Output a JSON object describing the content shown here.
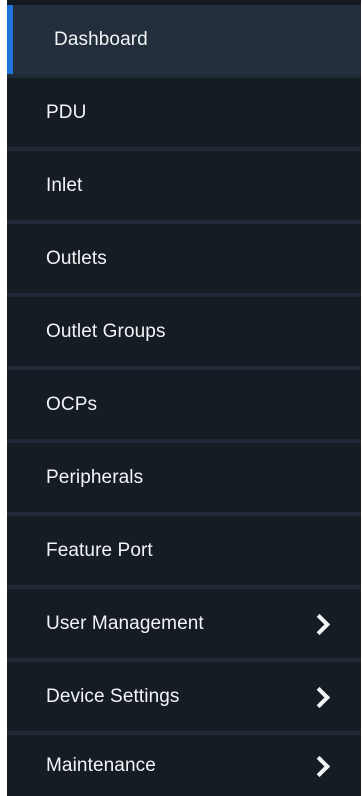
{
  "sidebar": {
    "colors": {
      "background": "#151c24",
      "active_background": "#232f3c",
      "active_indicator": "#1e74d8",
      "divider": "#1f2a36",
      "text": "#f2f4f6"
    },
    "items": [
      {
        "label": "Dashboard",
        "active": true,
        "has_submenu": false
      },
      {
        "label": "PDU",
        "active": false,
        "has_submenu": false
      },
      {
        "label": "Inlet",
        "active": false,
        "has_submenu": false
      },
      {
        "label": "Outlets",
        "active": false,
        "has_submenu": false
      },
      {
        "label": "Outlet Groups",
        "active": false,
        "has_submenu": false
      },
      {
        "label": "OCPs",
        "active": false,
        "has_submenu": false
      },
      {
        "label": "Peripherals",
        "active": false,
        "has_submenu": false
      },
      {
        "label": "Feature Port",
        "active": false,
        "has_submenu": false
      },
      {
        "label": "User Management",
        "active": false,
        "has_submenu": true,
        "icon": "chevron-right-icon"
      },
      {
        "label": "Device Settings",
        "active": false,
        "has_submenu": true,
        "icon": "chevron-right-icon"
      },
      {
        "label": "Maintenance",
        "active": false,
        "has_submenu": true,
        "icon": "chevron-right-icon"
      }
    ]
  }
}
